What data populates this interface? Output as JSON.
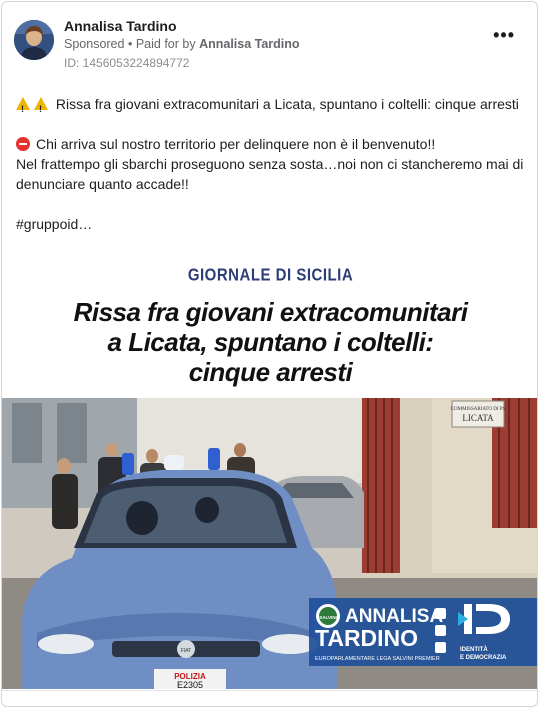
{
  "post": {
    "author": "Annalisa Tardino",
    "sponsored": "Sponsored",
    "separator": "•",
    "paid_for_prefix": "Paid for by",
    "paid_for_name": "Annalisa Tardino",
    "id_line": "ID: 1456053224894772",
    "more_icon": "•••",
    "text": {
      "line1": "Rissa fra giovani extracomunitari a Licata, spuntano i coltelli: cinque arresti",
      "line2": "Chi arriva sul nostro territorio per delinquere non è il benvenuto!!",
      "line3": "Nel frattempo gli sbarchi proseguono senza sosta…noi non ci stancheremo mai di denunciare quanto accade!!",
      "line4": "#gruppoid…"
    }
  },
  "image": {
    "source": "GIORNALE DI SICILIA",
    "headline1": "Rissa fra giovani extracomunitari",
    "headline2": "a Licata, spuntano i coltelli:",
    "headline3": "cinque arresti",
    "station_sign1": "COMMISSARIATO DI PS",
    "station_sign2": "LICATA",
    "car_label": "POLIZIA",
    "plate": "E2305",
    "car_brand": "FIAT",
    "banner": {
      "name1": "ANNALISA",
      "name2": "TARDINO",
      "subtitle": "EUROPARLAMENTARE LEGA SALVINI PREMIER",
      "party1": "IDENTITÀ",
      "party2": "E DEMOCRAZIA",
      "logo_text": "SALVINI"
    }
  },
  "colors": {
    "accent": "#2c3e78",
    "banner_blue": "#1f4f9a",
    "police_blue": "#6f8fc4"
  }
}
